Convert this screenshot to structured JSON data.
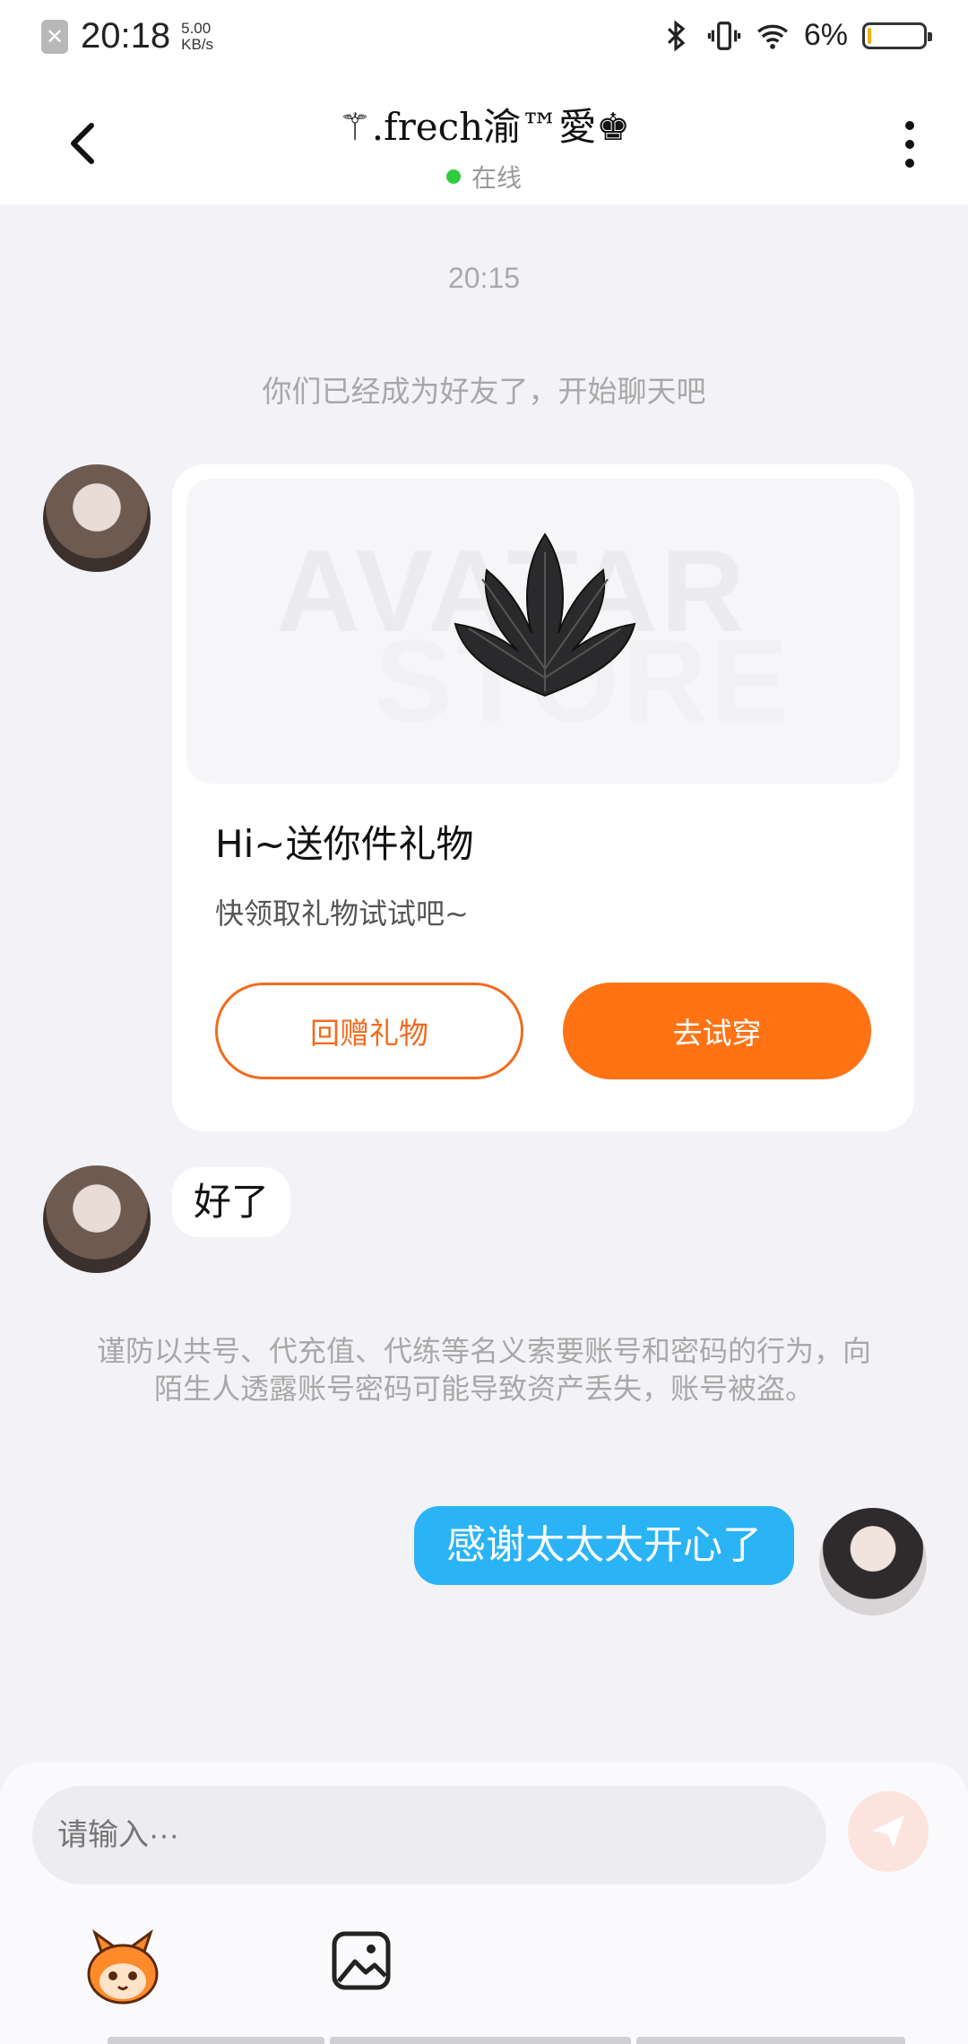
{
  "status_bar": {
    "time": "20:18",
    "speed_value": "5.00",
    "speed_unit": "KB/s",
    "battery_percent": "6%",
    "battery_level": 0.06,
    "icons": [
      "notification-blocked-icon",
      "bluetooth-icon",
      "vibrate-icon",
      "wifi-icon",
      "battery-icon"
    ]
  },
  "header": {
    "title": "⚚.frech渝™愛♚",
    "status": "在线",
    "status_color": "#2ecc40",
    "back_icon": "chevron-left-icon",
    "more_icon": "more-vertical-icon"
  },
  "chat": {
    "timestamp": "20:15",
    "friend_notice": "你们已经成为好友了，开始聊天吧",
    "gift_card": {
      "watermark_line1": "AVATAR",
      "watermark_line2": "STORE",
      "title": "Hi~送你件礼物",
      "subtitle": "快领取礼物试试吧~",
      "return_gift_label": "回赠礼物",
      "try_on_label": "去试穿",
      "accent_color": "#ff7315"
    },
    "incoming_message": "好了",
    "security_warning": "谨防以共号、代充值、代练等名义索要账号和密码的行为，向陌生人透露账号密码可能导致资产丢失，账号被盗。",
    "outgoing_message": "感谢太太太开心了",
    "outgoing_color": "#2ab3f5"
  },
  "composer": {
    "placeholder": "请输入···",
    "send_icon": "send-icon",
    "tools": [
      "mascot-icon",
      "image-icon"
    ]
  }
}
